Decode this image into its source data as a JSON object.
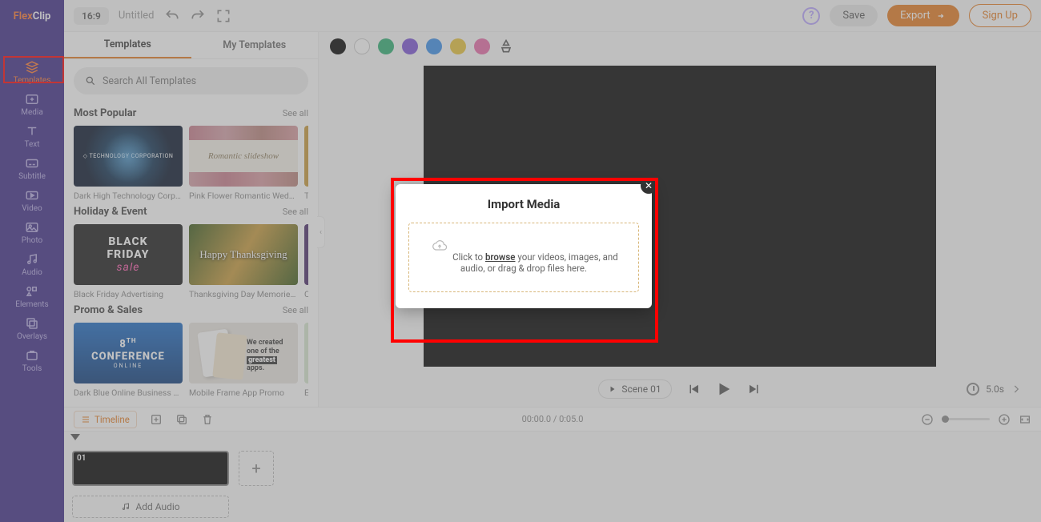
{
  "logo": {
    "brand_a": "Flex",
    "brand_b": "Clip"
  },
  "nav": {
    "templates": "Templates",
    "media": "Media",
    "text": "Text",
    "subtitle": "Subtitle",
    "video": "Video",
    "photo": "Photo",
    "audio": "Audio",
    "elements": "Elements",
    "overlays": "Overlays",
    "tools": "Tools"
  },
  "topbar": {
    "aspect": "16:9",
    "title": "Untitled",
    "save": "Save",
    "export": "Export",
    "signup": "Sign Up"
  },
  "panel": {
    "tab_templates": "Templates",
    "tab_my": "My Templates",
    "search_placeholder": "Search All Templates",
    "see_all": "See all",
    "sections": {
      "popular": {
        "title": "Most Popular",
        "c1": {
          "label": "Dark High Technology Corporate...",
          "txt": "TECHNOLOGY CORPORATION"
        },
        "c2": {
          "label": "Pink Flower Romantic Wedding ...",
          "txt": "Romantic slideshow"
        },
        "c3": {
          "label": "Tec"
        }
      },
      "holiday": {
        "title": "Holiday & Event",
        "c1": {
          "label": "Black Friday Advertising",
          "txt_a": "BLACK",
          "txt_b": "FRIDAY",
          "txt_c": "sale"
        },
        "c2": {
          "label": "Thanksgiving Day Memories Fa...",
          "txt": "Happy Thanksgiving"
        },
        "c3": {
          "label": "Cyb"
        }
      },
      "promo": {
        "title": "Promo & Sales",
        "c1": {
          "label": "Dark Blue Online Business Confe",
          "txt_top": "8",
          "txt_sup": "TH",
          "txt_main": "CONFERENCE",
          "txt_sub": "ONLINE"
        },
        "c2": {
          "label": "Mobile Frame App Promo",
          "txt": "We created one of the greatest apps."
        },
        "c3": {
          "label": "Eco"
        }
      }
    }
  },
  "colors": [
    "#000000",
    "#ffffff",
    "#2fb074",
    "#7a52d6",
    "#3a8eea",
    "#e8c43a",
    "#e86aa8"
  ],
  "playbar": {
    "scene": "Scene 01",
    "duration": "5.0s"
  },
  "timeline": {
    "btn": "Timeline",
    "time": "00:00.0 / 0:05.0",
    "scene_num": "01",
    "add_audio": "Add Audio"
  },
  "modal": {
    "title": "Import Media",
    "text_a": "Click to ",
    "text_b": "browse",
    "text_c": " your videos, images, and audio, or drag & drop files here."
  }
}
